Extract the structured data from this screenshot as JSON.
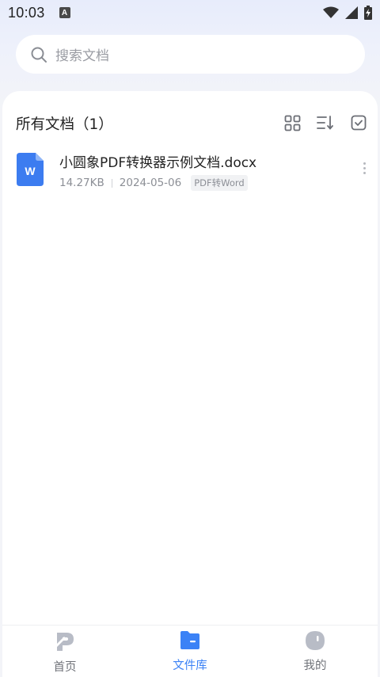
{
  "status_bar": {
    "time": "10:03",
    "notification_letter": "A"
  },
  "search": {
    "placeholder": "搜索文档"
  },
  "library": {
    "title": "所有文档（1）",
    "tools": [
      "grid-view-icon",
      "sort-icon",
      "select-icon"
    ]
  },
  "files": [
    {
      "name": "小圆象PDF转换器示例文档.docx",
      "size": "14.27KB",
      "date": "2024-05-06",
      "tag": "PDF转Word",
      "icon": "word-doc-icon",
      "icon_letter": "W"
    }
  ],
  "nav": {
    "items": [
      {
        "label": "首页",
        "icon": "home-logo-icon",
        "active": false
      },
      {
        "label": "文件库",
        "icon": "folder-icon",
        "active": true
      },
      {
        "label": "我的",
        "icon": "profile-icon",
        "active": false
      }
    ]
  },
  "colors": {
    "accent": "#3b82f6",
    "word_blue": "#3c7cf0",
    "nav_inactive": "#b8bcc6"
  }
}
